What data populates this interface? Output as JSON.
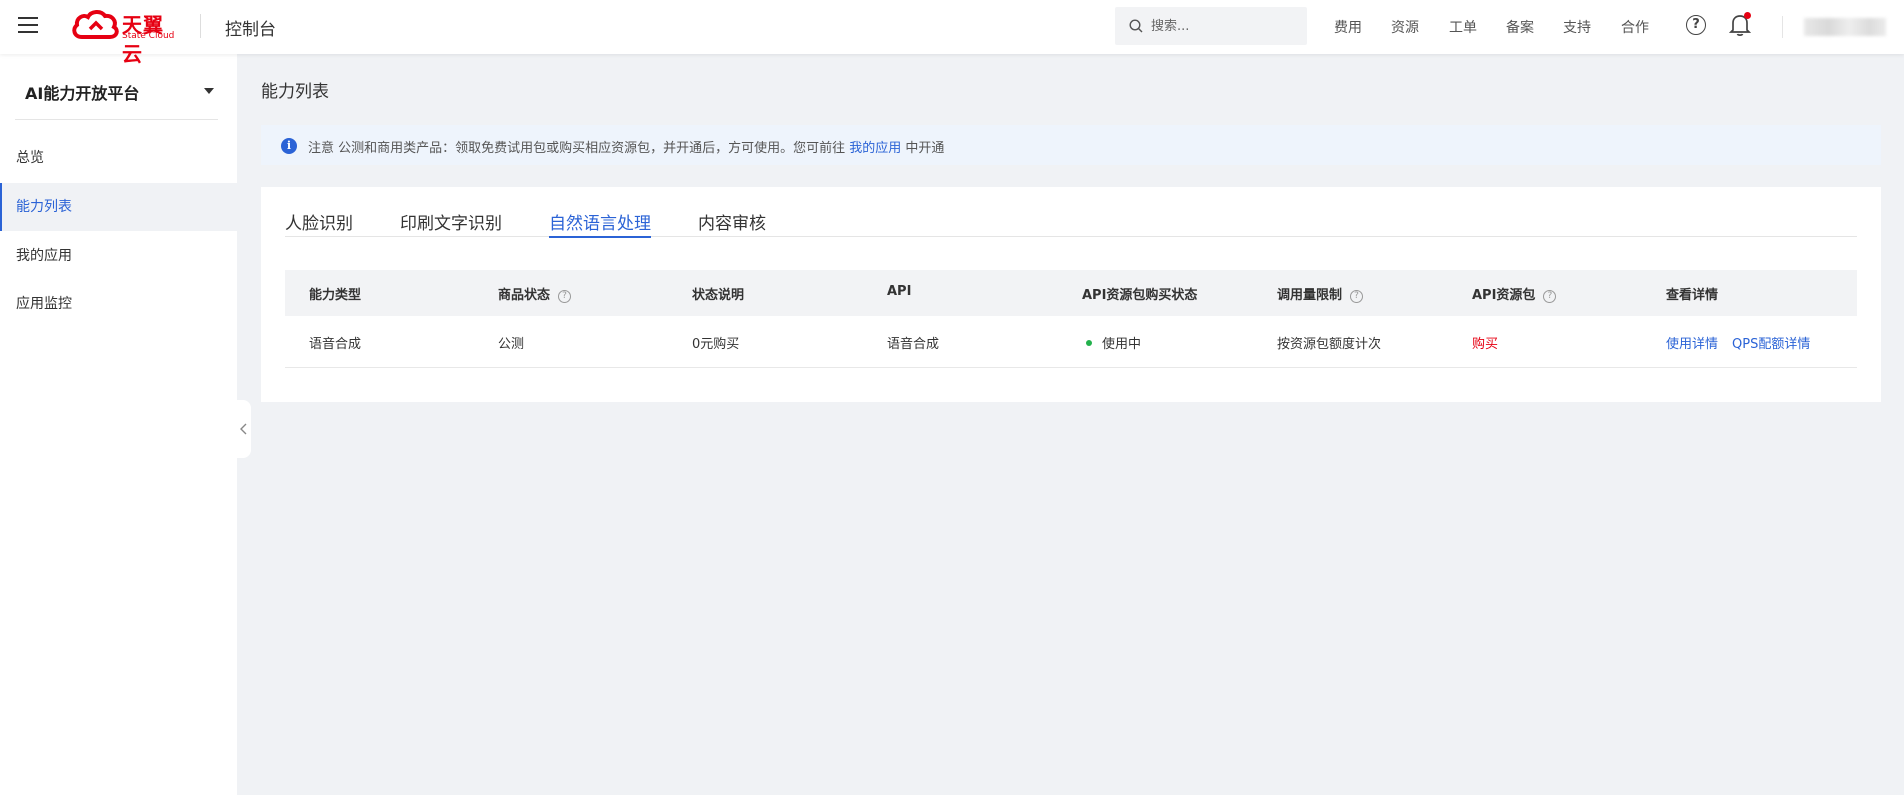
{
  "header": {
    "logo_main": "天翼云",
    "logo_sub": "State Cloud",
    "console_title": "控制台",
    "search_placeholder": "搜索...",
    "nav": [
      "费用",
      "资源",
      "工单",
      "备案",
      "支持",
      "合作"
    ],
    "help_symbol": "?",
    "brand_color": "#e60012"
  },
  "sidebar": {
    "title": "AI能力开放平台",
    "items": [
      {
        "label": "总览",
        "active": false
      },
      {
        "label": "能力列表",
        "active": true
      },
      {
        "label": "我的应用",
        "active": false
      },
      {
        "label": "应用监控",
        "active": false
      }
    ]
  },
  "main": {
    "page_title": "能力列表",
    "notice": {
      "icon": "i",
      "text_before": "注意 公测和商用类产品：领取免费试用包或购买相应资源包，并开通后，方可使用。您可前往 ",
      "link": "我的应用",
      "text_after": " 中开通"
    },
    "tabs": [
      {
        "label": "人脸识别",
        "active": false
      },
      {
        "label": "印刷文字识别",
        "active": false
      },
      {
        "label": "自然语言处理",
        "active": true
      },
      {
        "label": "内容审核",
        "active": false
      }
    ],
    "table": {
      "columns": [
        {
          "label": "能力类型",
          "help": false
        },
        {
          "label": "商品状态",
          "help": true
        },
        {
          "label": "状态说明",
          "help": false
        },
        {
          "label": "API",
          "help": false
        },
        {
          "label": "API资源包购买状态",
          "help": false
        },
        {
          "label": "调用量限制",
          "help": true
        },
        {
          "label": "API资源包",
          "help": true
        },
        {
          "label": "查看详情",
          "help": false
        }
      ],
      "rows": [
        {
          "type": "语音合成",
          "status": "公测",
          "desc": "0元购买",
          "api": "语音合成",
          "purchase_status": "使用中",
          "limit": "按资源包额度计次",
          "package": "购买",
          "detail_links": [
            "使用详情",
            "QPS配额详情"
          ]
        }
      ]
    },
    "accent_color": "#2b63d6",
    "status_dot_color": "#22b14c"
  }
}
